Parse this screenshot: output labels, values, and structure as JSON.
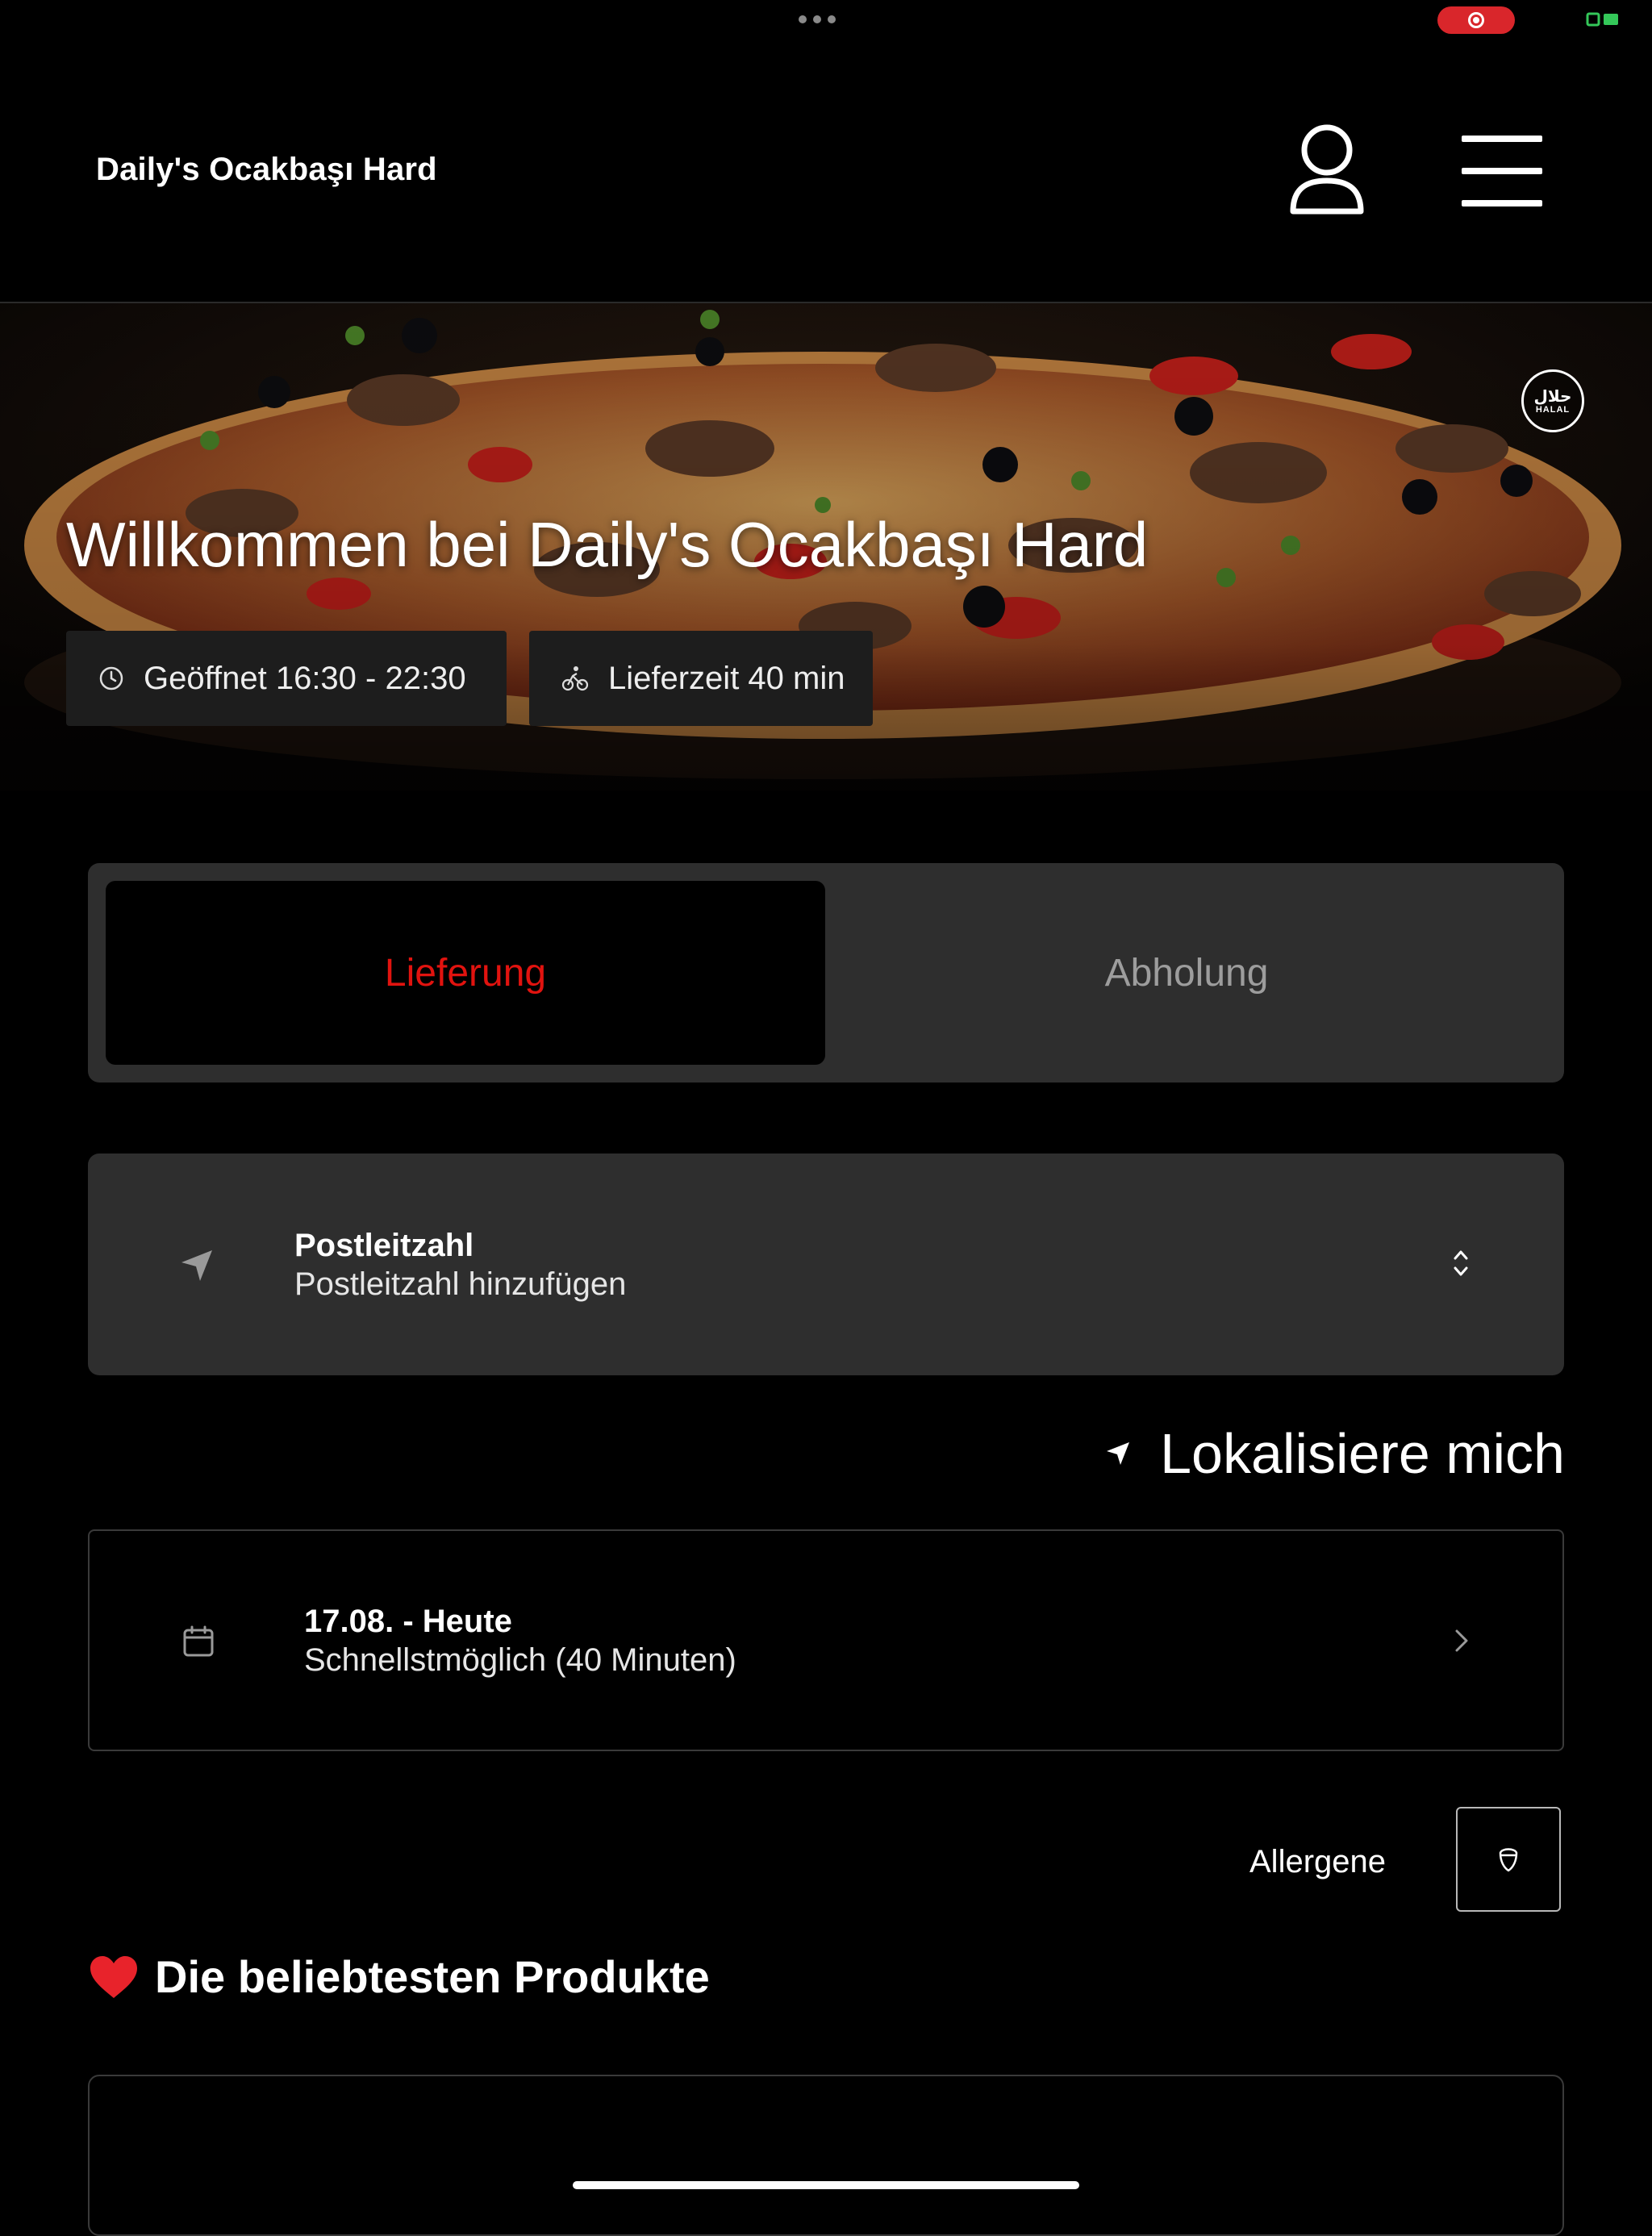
{
  "header": {
    "restaurant_name": "Daily's Ocakbaşı Hard"
  },
  "hero": {
    "badge_arabic": "حلال",
    "badge_text": "HALAL",
    "title": "Willkommen bei Daily's Ocakbaşı Hard",
    "opening_hours": "Geöffnet 16:30 - 22:30",
    "delivery_time": "Lieferzeit 40 min"
  },
  "tabs": [
    {
      "label": "Lieferung",
      "active": true
    },
    {
      "label": "Abholung",
      "active": false
    }
  ],
  "postal_code": {
    "title": "Postleitzahl",
    "placeholder": "Postleitzahl hinzufügen"
  },
  "locate": {
    "label": "Lokalisiere mich"
  },
  "schedule": {
    "date": "17.08. - Heute",
    "time": "Schnellstmöglich (40 Minuten)"
  },
  "allergens": {
    "label": "Allergene"
  },
  "popular": {
    "title": "Die beliebtesten Produkte"
  },
  "colors": {
    "background": "#000000",
    "card": "#2e2e2e",
    "accent_red": "#e1130f",
    "inactive_tab_text": "#9d9d9d"
  },
  "icons": [
    "user-icon",
    "menu-icon",
    "clock-icon",
    "bicycle-icon",
    "location-arrow-icon",
    "chevron-up-down-icon",
    "calendar-icon",
    "chevron-right-icon",
    "allergen-icon",
    "heart-icon"
  ]
}
